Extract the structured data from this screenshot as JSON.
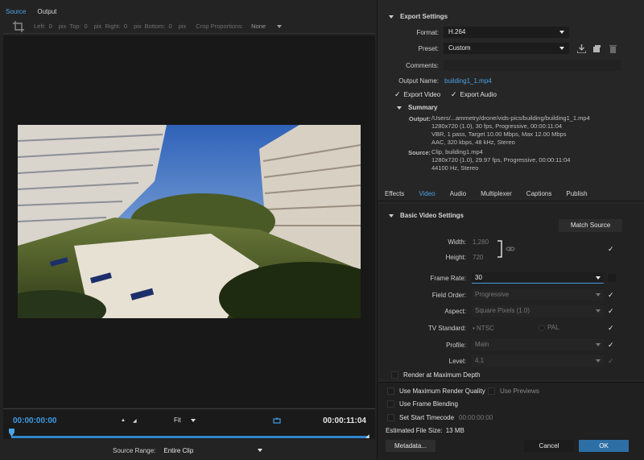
{
  "source_panel": {
    "tabs": [
      "Source",
      "Output"
    ],
    "crop": {
      "left_label": "Left:",
      "left_value": "0",
      "left_unit": "pix",
      "top_label": "Top:",
      "top_value": "0",
      "top_unit": "pix",
      "right_label": "Right:",
      "right_value": "0",
      "right_unit": "pix",
      "bottom_label": "Bottom:",
      "bottom_value": "0",
      "bottom_unit": "pix",
      "proportions_label": "Crop Proportions:",
      "proportions_value": "None"
    },
    "timecode_start": "00:00:00:00",
    "timecode_end": "00:00:11:04",
    "zoom_value": "Fit",
    "source_range_label": "Source Range:",
    "source_range_value": "Entire Clip"
  },
  "export_settings": {
    "title": "Export Settings",
    "format_label": "Format:",
    "format_value": "H.264",
    "preset_label": "Preset:",
    "preset_value": "Custom",
    "comments_label": "Comments:",
    "comments_value": "",
    "output_name_label": "Output Name:",
    "output_name_value": "building1_1.mp4",
    "export_video_label": "Export Video",
    "export_audio_label": "Export Audio",
    "summary_title": "Summary",
    "output_label": "Output:",
    "output_lines": [
      "/Users/...ammetry/drone/vids-pics/building/building1_1.mp4",
      "1280x720 (1.0), 30 fps, Progressive, 00:00:11:04",
      "VBR, 1 pass, Target 10.00 Mbps, Max 12.00 Mbps",
      "AAC, 320 kbps, 48 kHz, Stereo"
    ],
    "source_label": "Source:",
    "source_lines": [
      "Clip, building1.mp4",
      "1280x720 (1.0), 29.97 fps, Progressive, 00:00:11:04",
      "44100 Hz, Stereo"
    ]
  },
  "settings_tabs": [
    "Effects",
    "Video",
    "Audio",
    "Multiplexer",
    "Captions",
    "Publish"
  ],
  "basic_video": {
    "title": "Basic Video Settings",
    "match_source_label": "Match Source",
    "width_label": "Width:",
    "width_value": "1,280",
    "height_label": "Height:",
    "height_value": "720",
    "frame_rate_label": "Frame Rate:",
    "frame_rate_value": "30",
    "field_order_label": "Field Order:",
    "field_order_value": "Progressive",
    "aspect_label": "Aspect:",
    "aspect_value": "Square Pixels (1.0)",
    "tv_standard_label": "TV Standard:",
    "tv_ntsc": "NTSC",
    "tv_pal": "PAL",
    "profile_label": "Profile:",
    "profile_value": "Main",
    "level_label": "Level:",
    "level_value": "4.1",
    "render_max_depth_label": "Render at Maximum Depth"
  },
  "bottom": {
    "max_render_label": "Use Maximum Render Quality",
    "use_previews_label": "Use Previews",
    "frame_blending_label": "Use Frame Blending",
    "start_timecode_label": "Set Start Timecode",
    "start_timecode_value": "00:00:00:00",
    "file_size_label": "Estimated File Size:",
    "file_size_value": "13 MB",
    "metadata_label": "Metadata...",
    "cancel_label": "Cancel",
    "ok_label": "OK"
  },
  "colors": {
    "accent": "#4da3e6",
    "primary_button": "#2d6fa5",
    "scrub": "#2f87cf"
  }
}
